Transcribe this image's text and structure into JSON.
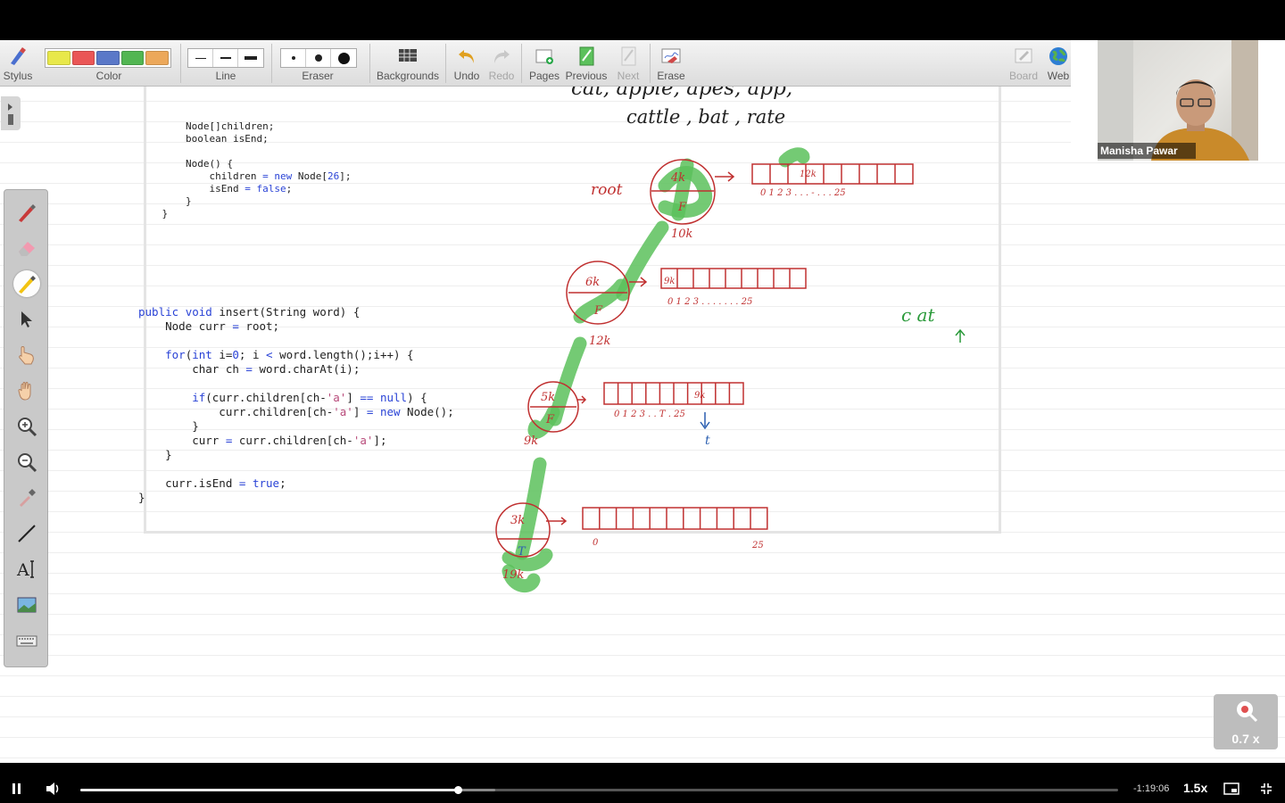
{
  "toolbar": {
    "stylus_label": "Stylus",
    "color_label": "Color",
    "line_label": "Line",
    "eraser_label": "Eraser",
    "backgrounds_label": "Backgrounds",
    "undo_label": "Undo",
    "redo_label": "Redo",
    "pages_label": "Pages",
    "previous_label": "Previous",
    "next_label": "Next",
    "erase_label": "Erase",
    "board_label": "Board",
    "web_label": "Web",
    "colors": [
      "#e8e84a",
      "#ea5656",
      "#5a78c8",
      "#52b652",
      "#eca85a"
    ]
  },
  "side_tools": [
    "pen-icon",
    "highlighter-eraser-icon",
    "highlighter-icon",
    "pointer-icon",
    "laser-hand-icon",
    "hand-icon",
    "zoom-in-icon",
    "zoom-out-icon",
    "eyedropper-icon",
    "line-icon",
    "text-icon",
    "image-icon",
    "keyboard-icon"
  ],
  "code": {
    "class_lines": [
      "        Node[]children;",
      "        boolean isEnd;",
      "",
      "        Node() {",
      "            children = new Node[26];",
      "            isEnd = false;",
      "        }",
      "    }"
    ],
    "insert_lines": [
      "public void insert(String word) {",
      "    Node curr = root;",
      "",
      "    for(int i=0; i < word.length();i++) {",
      "        char ch = word.charAt(i);",
      "",
      "        if(curr.children[ch-'a'] == null) {",
      "            curr.children[ch-'a'] = new Node();",
      "        }",
      "        curr = curr.children[ch-'a'];",
      "    }",
      "",
      "    curr.isEnd = true;",
      "}"
    ]
  },
  "whiteboard": {
    "words_line1": "cat,   apple,  apes,  app,",
    "words_line2": "cattle ,  bat ,  rate",
    "root_label": "root",
    "nodes": [
      {
        "addr": "4k",
        "letter": "F",
        "below": "10k"
      },
      {
        "addr": "6k",
        "letter": "F",
        "below": "12k"
      },
      {
        "addr": "5k",
        "letter": "F",
        "below": "9k"
      },
      {
        "addr": "3k",
        "letter": "T",
        "below": "19k"
      }
    ],
    "arrays": [
      {
        "cell_value": "12k",
        "index_labels": "0  1  2  3 . . . - . . . 25"
      },
      {
        "cell_value": "9k",
        "index_labels": "0  1  2  3 . . . . . . . 25"
      },
      {
        "cell_value": "9k",
        "index_labels": "0  1  2  3 . . T . 25",
        "note": "t"
      },
      {
        "cell_value": "",
        "index_labels_start": "0",
        "index_labels_end": "25"
      }
    ],
    "side_note": "c at"
  },
  "webcam": {
    "name": "Manisha Pawar"
  },
  "zoom": {
    "label": "0.7 x"
  },
  "player": {
    "time_remaining": "-1:19:06",
    "speed": "1.5x",
    "progress": 0.364
  }
}
